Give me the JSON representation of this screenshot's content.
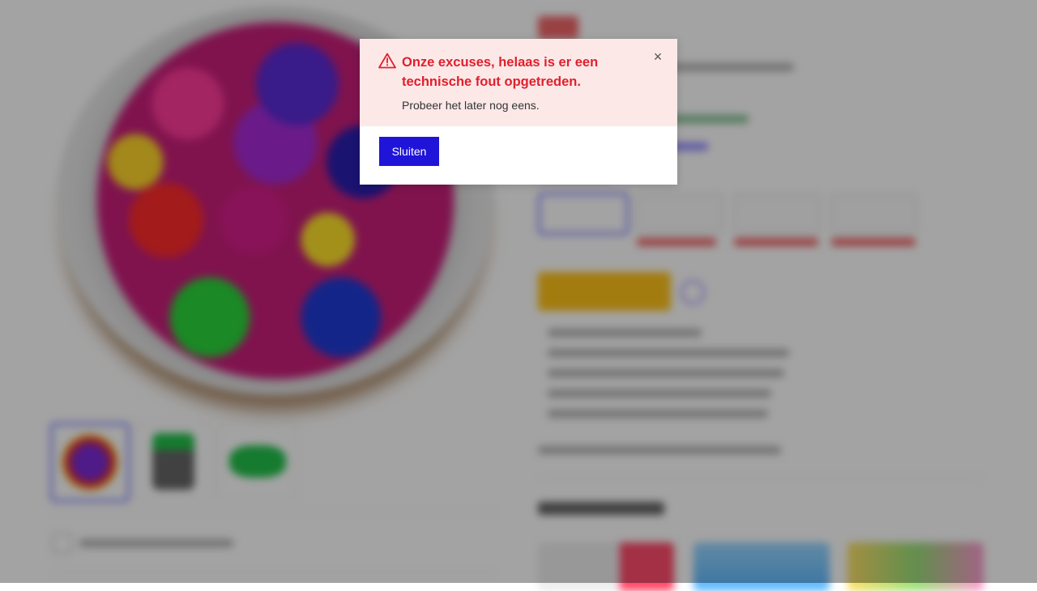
{
  "modal": {
    "title": "Onze excuses, helaas is er een technische fout opgetreden.",
    "message": "Probeer het later nog eens.",
    "close_button_label": "Sluiten",
    "close_icon": "×",
    "icon": "warning-triangle-icon"
  },
  "colors": {
    "alert_bg": "#fde8e8",
    "alert_text": "#e0202c",
    "primary_button": "#1f14d8",
    "overlay": "rgba(0,0,0,0.36)"
  }
}
